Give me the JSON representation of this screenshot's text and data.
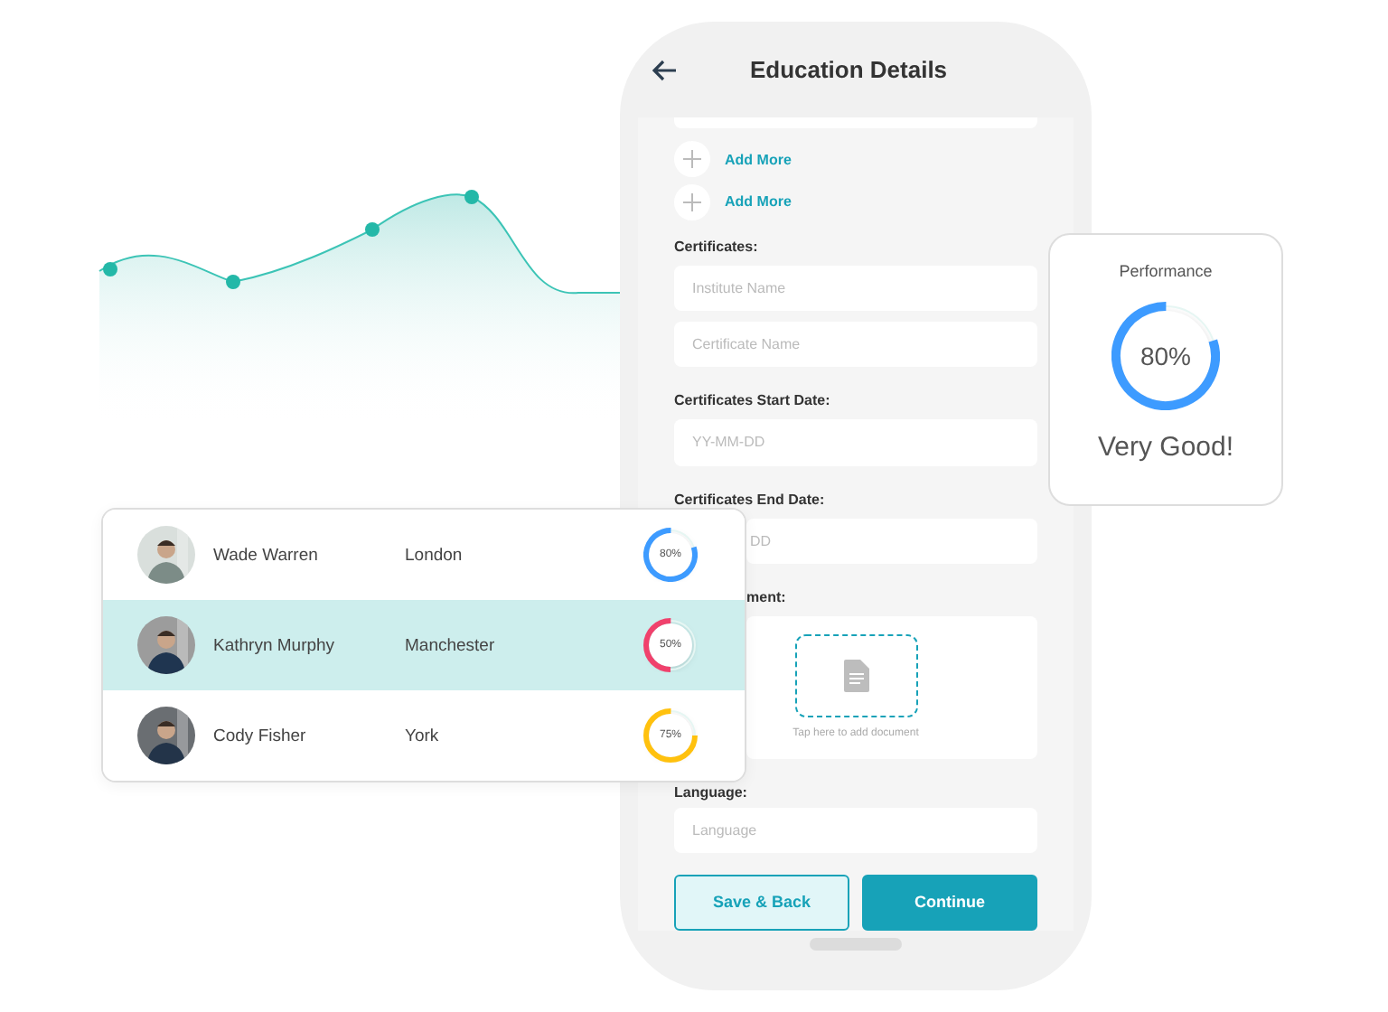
{
  "form": {
    "title": "Education Details",
    "add_more": [
      "Add More",
      "Add More"
    ],
    "items": [
      {
        "kind": "label",
        "text": "Certificates:"
      },
      {
        "kind": "field",
        "placeholder": "Institute Name"
      },
      {
        "kind": "field",
        "placeholder": "Certificate Name"
      },
      {
        "kind": "label",
        "text": "Certificates Start Date:"
      },
      {
        "kind": "field",
        "placeholder": "YY-MM-DD"
      },
      {
        "kind": "label",
        "text": "Certificates End Date:"
      },
      {
        "kind": "field",
        "placeholder": "DD",
        "partial": true
      },
      {
        "kind": "label",
        "text": "ment:",
        "partial": true
      },
      {
        "kind": "upload",
        "hint": "Tap here to add document"
      },
      {
        "kind": "label",
        "text": "Language:"
      },
      {
        "kind": "field",
        "placeholder": "Language"
      }
    ],
    "buttons": [
      {
        "label": "Save & Back",
        "kind": "secondary"
      },
      {
        "label": "Continue",
        "kind": "primary"
      }
    ]
  },
  "people": [
    {
      "name": "Wade Warren",
      "city": "London",
      "reading": "80%",
      "level": 0.8,
      "color": "#3d9bff",
      "selected": false
    },
    {
      "name": "Kathryn Murphy",
      "city": "Manchester",
      "reading": "50%",
      "level": 0.5,
      "color": "#f0416c",
      "selected": true
    },
    {
      "name": "Cody Fisher",
      "city": "York",
      "reading": "75%",
      "level": 0.75,
      "color": "#ffc10e",
      "selected": false
    }
  ],
  "performance": {
    "title": "Performance",
    "reading": "80%",
    "level": 0.8,
    "color": "#3d9bff",
    "verdict": "Very Good!"
  }
}
